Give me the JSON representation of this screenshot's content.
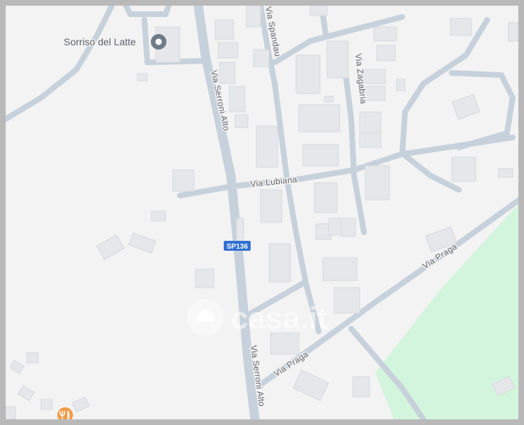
{
  "map": {
    "streets": {
      "via_serroni_alto_north": "Via Serroni Alto",
      "via_serroni_alto_south": "Via Serroni Alto",
      "via_spandau": "Via Spandau",
      "via_zagabria": "Via Zagabria",
      "via_lubiana": "Via Lubiana",
      "via_praga_east": "Via Praga",
      "via_praga_west": "Via Praga"
    },
    "route_shield": "SP136",
    "poi": {
      "name": "Sorriso del Latte",
      "icon": "place-pin-icon",
      "restaurant_icon": "restaurant-icon"
    },
    "watermark": "casa.it",
    "colors": {
      "background": "#f3f3f3",
      "road": "#c7d1dc",
      "building": "#e6e7ea",
      "park": "#d4f5dd",
      "shield": "#2f6fd2",
      "poi_pin": "#6f7b88",
      "restaurant": "#f29a4a"
    }
  }
}
